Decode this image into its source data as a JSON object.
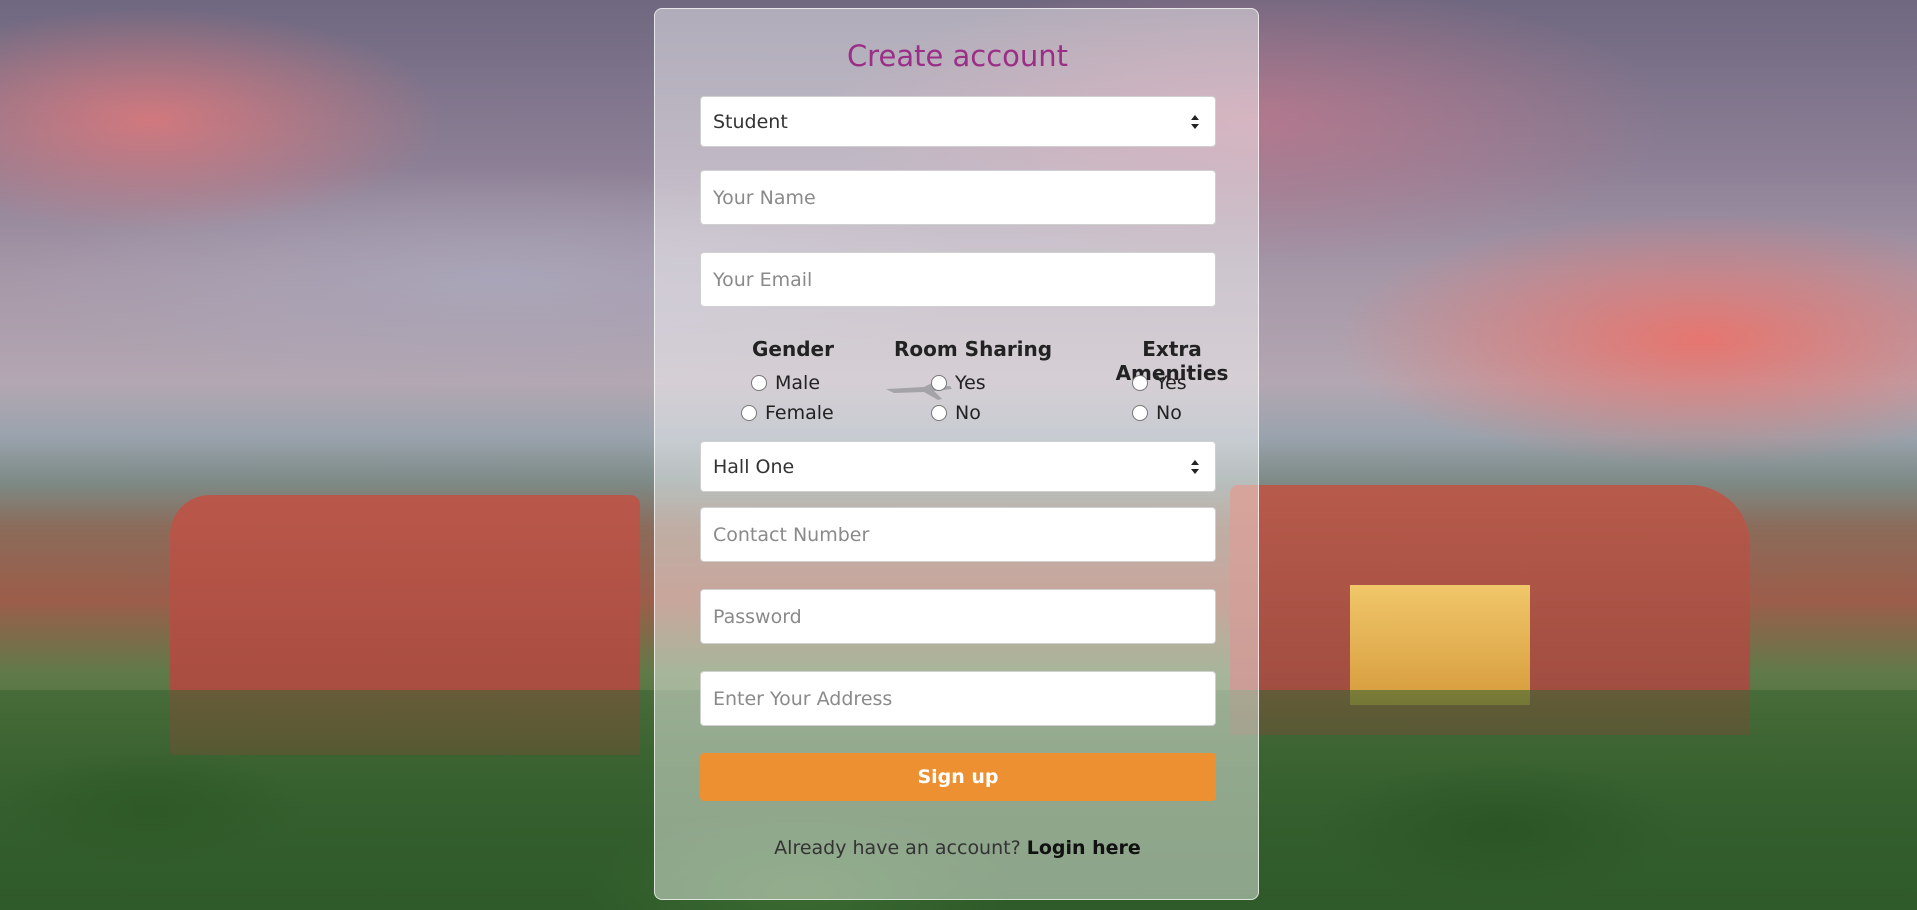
{
  "form": {
    "title": "Create account",
    "role_select": {
      "selected": "Student"
    },
    "name_field": {
      "placeholder": "Your Name"
    },
    "email_field": {
      "placeholder": "Your Email"
    },
    "gender": {
      "label": "Gender",
      "options": [
        "Male",
        "Female"
      ]
    },
    "room_sharing": {
      "label": "Room Sharing",
      "options": [
        "Yes",
        "No"
      ]
    },
    "extra_amenities": {
      "label": "Extra Amenities",
      "options": [
        "Yes",
        "No"
      ]
    },
    "hall_select": {
      "selected": "Hall One"
    },
    "contact_field": {
      "placeholder": "Contact Number"
    },
    "password_field": {
      "placeholder": "Password"
    },
    "address_field": {
      "placeholder": "Enter Your Address"
    },
    "submit_label": "Sign up",
    "login_prompt": "Already have an account?",
    "login_link": "Login here"
  },
  "colors": {
    "title": "#9b2e86",
    "submit": "#ec9032"
  }
}
